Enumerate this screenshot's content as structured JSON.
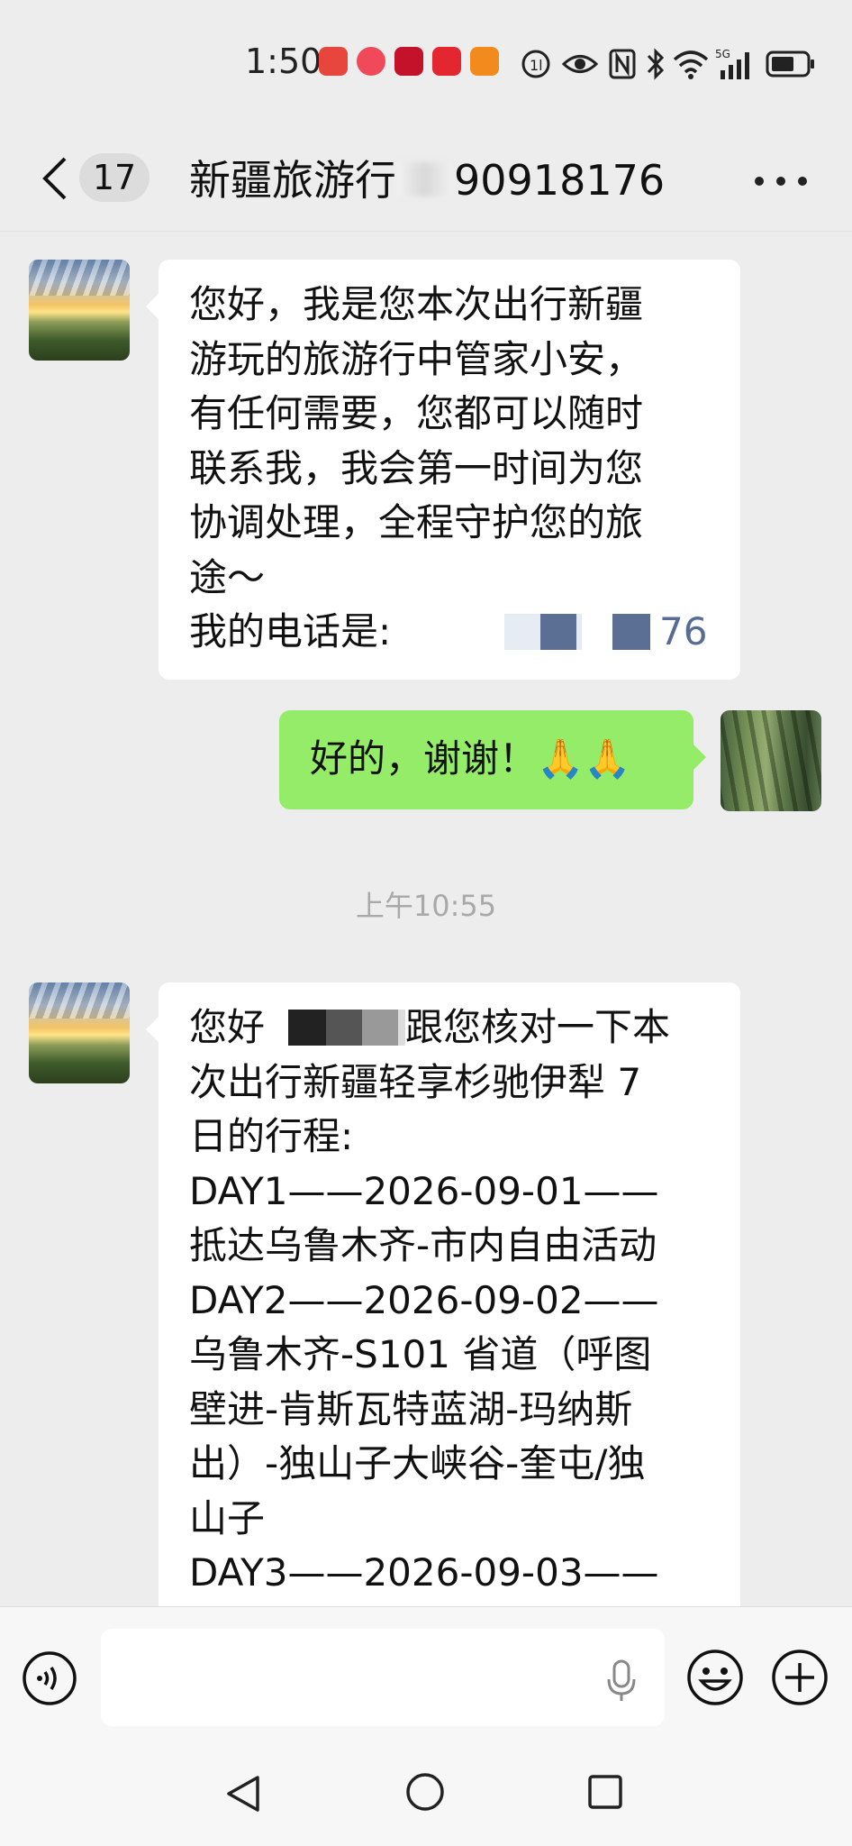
{
  "status_bar": {
    "time": "1:50",
    "indicators": [
      "nfc-icon",
      "eye-icon",
      "n-icon",
      "bluetooth-icon",
      "wifi-icon",
      "signal-5g-icon",
      "battery-icon"
    ]
  },
  "header": {
    "unread_count": "17",
    "title": "新疆旅游行",
    "title_suffix": "90918176"
  },
  "messages": [
    {
      "side": "in",
      "lines": [
        "您好，我是您本次出行新疆",
        "游玩的旅游行中管家小安，",
        "有任何需要，您都可以随时",
        "联系我，我会第一时间为您",
        "协调处理，全程守护您的旅",
        "途～",
        "我的电话是:"
      ],
      "phone_suffix": "76"
    },
    {
      "side": "out",
      "text": "好的，谢谢！🙏🙏"
    }
  ],
  "timestamp": "上午10:55",
  "message3": {
    "side": "in",
    "first_line_prefix": "您好",
    "first_line_suffix": "跟您核对一下本",
    "lines": [
      "次出行新疆轻享杉驰伊犁 7",
      "日的行程:",
      "DAY1——2026-09-01——",
      "抵达乌鲁木齐-市内自由活动",
      "DAY2——2026-09-02——",
      "乌鲁木齐-S101 省道（呼图",
      "壁进-肯斯瓦特蓝湖-玛纳斯",
      "出）-独山子大峡谷-奎屯/独",
      "山子",
      "DAY3——2026-09-03——"
    ]
  },
  "input_bar": {
    "placeholder": ""
  }
}
